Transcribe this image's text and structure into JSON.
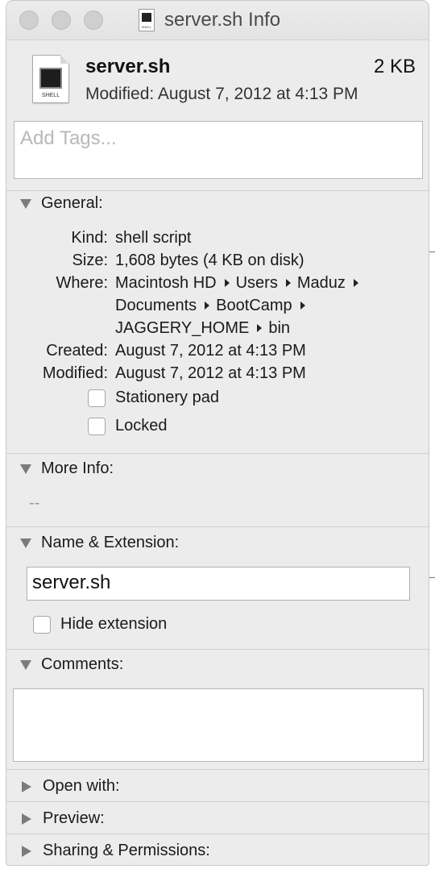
{
  "window": {
    "title": "server.sh Info",
    "title_icon": "shell-script-file-icon"
  },
  "header": {
    "file_name": "server.sh",
    "file_size": "2 KB",
    "modified": "Modified: August 7, 2012 at 4:13 PM",
    "icon_label": "SHELL"
  },
  "tags": {
    "placeholder": "Add Tags..."
  },
  "general": {
    "title": "General:",
    "kind_label": "Kind:",
    "kind": "shell script",
    "size_label": "Size:",
    "size": "1,608 bytes (4 KB on disk)",
    "where_label": "Where:",
    "path": [
      "Macintosh HD",
      "Users",
      "Maduz",
      "Documents",
      "BootCamp",
      "JAGGERY_HOME",
      "bin"
    ],
    "created_label": "Created:",
    "created": "August 7, 2012 at 4:13 PM",
    "modified_label": "Modified:",
    "modified": "August 7, 2012 at 4:13 PM",
    "stationery_label": "Stationery pad",
    "locked_label": "Locked"
  },
  "more_info": {
    "title": "More Info:",
    "value": "--"
  },
  "name_ext": {
    "title": "Name & Extension:",
    "value": "server.sh",
    "hide_ext_label": "Hide extension"
  },
  "comments": {
    "title": "Comments:"
  },
  "collapsed": {
    "open_with": "Open with:",
    "preview": "Preview:",
    "sharing": "Sharing & Permissions:"
  }
}
